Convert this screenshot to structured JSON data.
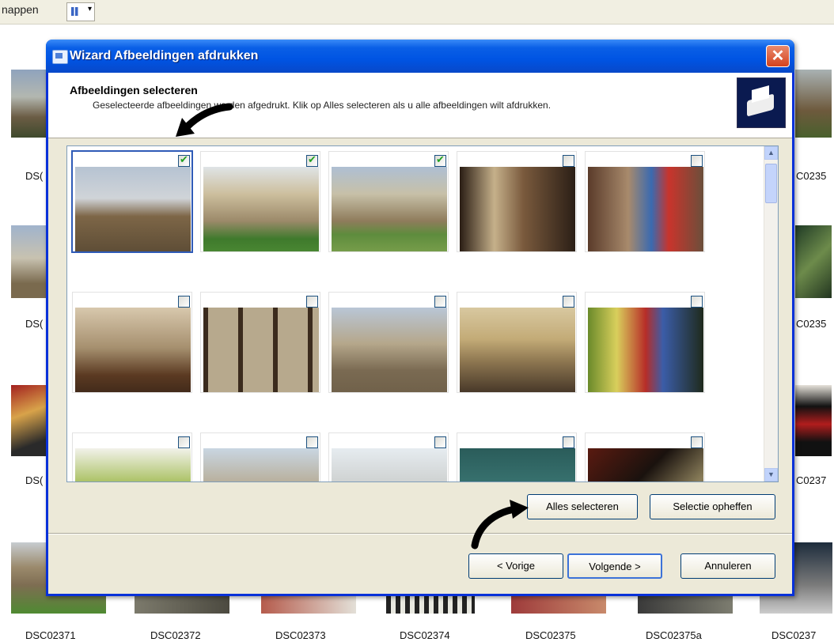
{
  "background": {
    "toolbar_text": "nappen",
    "file_labels": [
      "DSC02371",
      "DSC02372",
      "DSC02373",
      "DSC02374",
      "DSC02375",
      "DSC02375a",
      "DSC0237"
    ],
    "left_labels": [
      "DS(",
      "DS(",
      "DS("
    ],
    "right_labels": [
      "C0235",
      "C0235",
      "C0237"
    ]
  },
  "dialog": {
    "title": "Wizard Afbeeldingen afdrukken",
    "close_label": "✕",
    "header_title": "Afbeeldingen selecteren",
    "header_description": "Geselecteerde afbeeldingen worden afgedrukt. Klik op Alles selecteren als u alle afbeeldingen wilt afdrukken.",
    "thumbnails": [
      {
        "checked": true,
        "scene": "church"
      },
      {
        "checked": true,
        "scene": "college"
      },
      {
        "checked": true,
        "scene": "tower"
      },
      {
        "checked": false,
        "scene": "hall"
      },
      {
        "checked": false,
        "scene": "person-hall"
      },
      {
        "checked": false,
        "scene": "chapel"
      },
      {
        "checked": false,
        "scene": "gate"
      },
      {
        "checked": false,
        "scene": "tower2"
      },
      {
        "checked": false,
        "scene": "library"
      },
      {
        "checked": false,
        "scene": "shop"
      },
      {
        "checked": false,
        "scene": "yellow"
      },
      {
        "checked": false,
        "scene": "street"
      },
      {
        "checked": false,
        "scene": "building"
      },
      {
        "checked": false,
        "scene": "teal"
      },
      {
        "checked": false,
        "scene": "dark"
      }
    ],
    "select_all_label": "Alles selecteren",
    "clear_selection_label": "Selectie opheffen",
    "back_label": "< Vorige",
    "next_label": "Volgende >",
    "cancel_label": "Annuleren"
  },
  "colors": {
    "title_bar": "#0054e3",
    "dialog_bg": "#ece9d8",
    "check": "#21a121"
  }
}
